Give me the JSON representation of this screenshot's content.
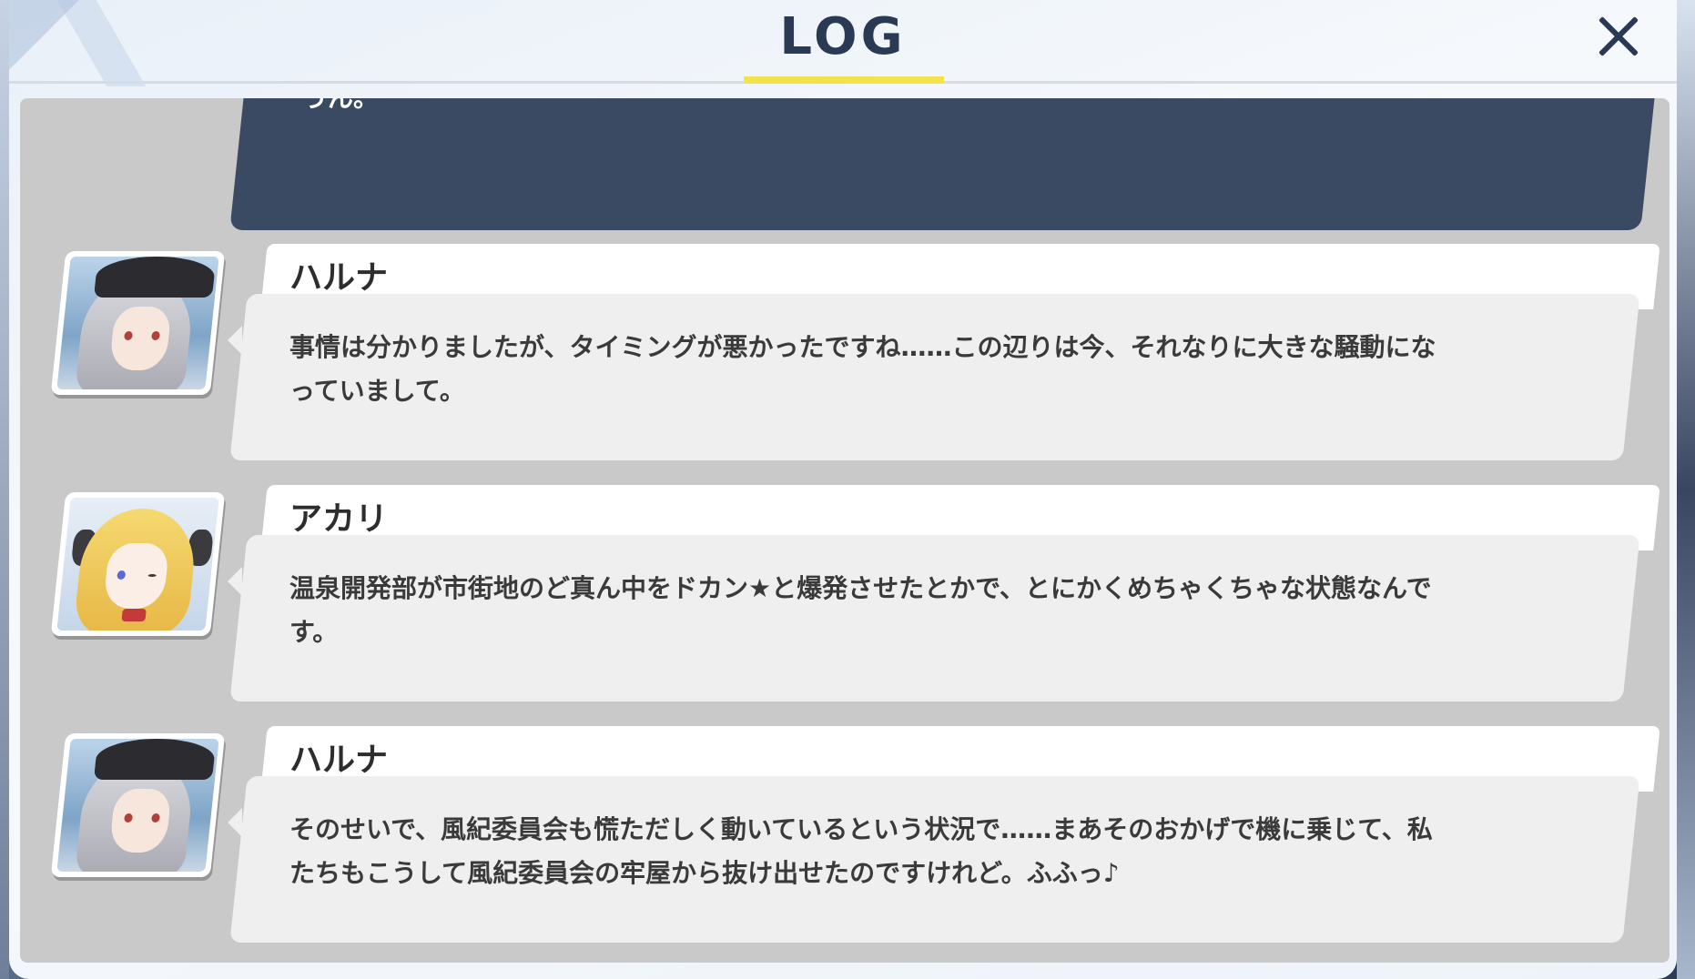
{
  "header": {
    "title": "LOG",
    "accent_color": "#f3e24a"
  },
  "close": {
    "icon": "close-icon"
  },
  "player_line": {
    "text": "うん。"
  },
  "entries": [
    {
      "speaker": "ハルナ",
      "text": "事情は分かりましたが、タイミングが悪かったですね……この辺りは今、それなりに大きな騒動になっていまして。",
      "avatar": "haruna-portrait"
    },
    {
      "speaker": "アカリ",
      "text": "温泉開発部が市街地のど真ん中をドカン★と爆発させたとかで、とにかくめちゃくちゃな状態なんです。",
      "avatar": "akari-portrait"
    },
    {
      "speaker": "ハルナ",
      "text": "そのせいで、風紀委員会も慌ただしく動いているという状況で……まあそのおかげで機に乗じて、私たちもこうして風紀委員会の牢屋から抜け出せたのですけれど。ふふっ♪",
      "avatar": "haruna-portrait"
    }
  ],
  "colors": {
    "player_bubble": "#3a4a62",
    "scroll_bg": "#c9c9c9",
    "title_text": "#2a3a55"
  }
}
